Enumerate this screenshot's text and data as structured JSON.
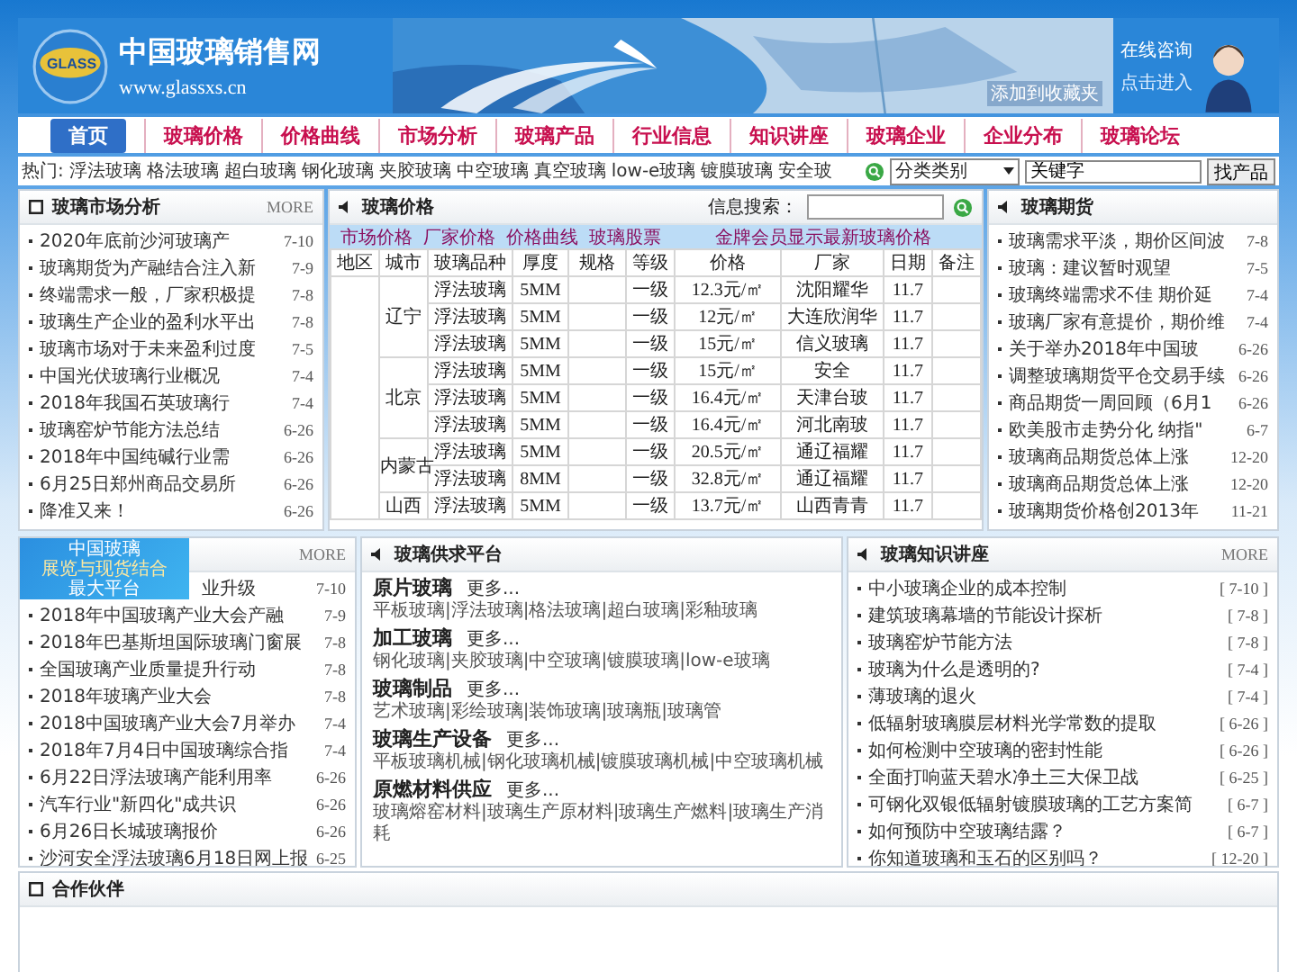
{
  "header": {
    "logo_badge": "GLASS",
    "site_name": "中国玻璃销售网",
    "site_url": "www.glassxs.cn",
    "bookmark_link": "添加到收藏夹",
    "consult_title": "在线咨询",
    "consult_link": "点击进入"
  },
  "nav": [
    {
      "label": "首页",
      "selected": true
    },
    {
      "label": "玻璃价格",
      "selected": false
    },
    {
      "label": "价格曲线",
      "selected": false
    },
    {
      "label": "市场分析",
      "selected": false
    },
    {
      "label": "玻璃产品",
      "selected": false
    },
    {
      "label": "行业信息",
      "selected": false
    },
    {
      "label": "知识讲座",
      "selected": false
    },
    {
      "label": "玻璃企业",
      "selected": false
    },
    {
      "label": "企业分布",
      "selected": false
    },
    {
      "label": "玻璃论坛",
      "selected": false
    }
  ],
  "hot": {
    "label": "热门:",
    "items": [
      "浮法玻璃",
      "格法玻璃",
      "超白玻璃",
      "钢化玻璃",
      "夹胶玻璃",
      "中空玻璃",
      "真空玻璃",
      "low-e玻璃",
      "镀膜玻璃",
      "安全玻"
    ]
  },
  "search": {
    "category": "分类类别",
    "keyword": "关键字",
    "button": "找产品"
  },
  "market_analysis": {
    "title": "玻璃市场分析",
    "more": "MORE",
    "items": [
      {
        "title": "2020年底前沙河玻璃产",
        "date": "7-10"
      },
      {
        "title": "玻璃期货为产融结合注入新",
        "date": "7-9"
      },
      {
        "title": "终端需求一般，厂家积极提",
        "date": "7-8"
      },
      {
        "title": "玻璃生产企业的盈利水平出",
        "date": "7-8"
      },
      {
        "title": "玻璃市场对于未来盈利过度",
        "date": "7-5"
      },
      {
        "title": "中国光伏玻璃行业概况",
        "date": "7-4"
      },
      {
        "title": "2018年我国石英玻璃行",
        "date": "7-4"
      },
      {
        "title": "玻璃窑炉节能方法总结",
        "date": "6-26"
      },
      {
        "title": "2018年中国纯碱行业需",
        "date": "6-26"
      },
      {
        "title": "6月25日郑州商品交易所",
        "date": "6-26"
      },
      {
        "title": "降准又来！",
        "date": "6-26"
      }
    ]
  },
  "prices": {
    "title": "玻璃价格",
    "search_label": "信息搜索：",
    "tabs": [
      "市场价格",
      "厂家价格",
      "价格曲线",
      "玻璃股票"
    ],
    "notice": "金牌会员显示最新玻璃价格",
    "columns": [
      "地区",
      "城市",
      "玻璃品种",
      "厚度",
      "规格",
      "等级",
      "价格",
      "厂家",
      "日期",
      "备注"
    ],
    "groups": [
      {
        "city": "辽宁",
        "rows": [
          {
            "variety": "浮法玻璃",
            "thickness": "5MM",
            "grade": "一级",
            "price": "12.3元/㎡",
            "maker": "沈阳耀华",
            "date": "11.7"
          },
          {
            "variety": "浮法玻璃",
            "thickness": "5MM",
            "grade": "一级",
            "price": "12元/㎡",
            "maker": "大连欣润华",
            "date": "11.7"
          },
          {
            "variety": "浮法玻璃",
            "thickness": "5MM",
            "grade": "一级",
            "price": "15元/㎡",
            "maker": "信义玻璃",
            "date": "11.7"
          }
        ]
      },
      {
        "city": "北京",
        "rows": [
          {
            "variety": "浮法玻璃",
            "thickness": "5MM",
            "grade": "一级",
            "price": "15元/㎡",
            "maker": "安全",
            "date": "11.7"
          },
          {
            "variety": "浮法玻璃",
            "thickness": "5MM",
            "grade": "一级",
            "price": "16.4元/㎡",
            "maker": "天津台玻",
            "date": "11.7"
          },
          {
            "variety": "浮法玻璃",
            "thickness": "5MM",
            "grade": "一级",
            "price": "16.4元/㎡",
            "maker": "河北南玻",
            "date": "11.7"
          }
        ]
      },
      {
        "city": "内蒙古",
        "rows": [
          {
            "variety": "浮法玻璃",
            "thickness": "5MM",
            "grade": "一级",
            "price": "20.5元/㎡",
            "maker": "通辽福耀",
            "date": "11.7"
          },
          {
            "variety": "浮法玻璃",
            "thickness": "8MM",
            "grade": "一级",
            "price": "32.8元/㎡",
            "maker": "通辽福耀",
            "date": "11.7"
          }
        ]
      },
      {
        "city": "山西",
        "rows": [
          {
            "variety": "浮法玻璃",
            "thickness": "5MM",
            "grade": "一级",
            "price": "13.7元/㎡",
            "maker": "山西青青",
            "date": "11.7"
          }
        ]
      }
    ]
  },
  "futures": {
    "title": "玻璃期货",
    "items": [
      {
        "title": "玻璃需求平淡，期价区间波",
        "date": "7-8"
      },
      {
        "title": "玻璃：建议暂时观望",
        "date": "7-5"
      },
      {
        "title": "玻璃终端需求不佳 期价延",
        "date": "7-4"
      },
      {
        "title": "玻璃厂家有意提价，期价维",
        "date": "7-4"
      },
      {
        "title": "关于举办2018年中国玻",
        "date": "6-26"
      },
      {
        "title": "调整玻璃期货平仓交易手续",
        "date": "6-26"
      },
      {
        "title": "商品期货一周回顾（6月1",
        "date": "6-26"
      },
      {
        "title": "欧美股市走势分化 纳指\"",
        "date": "6-7"
      },
      {
        "title": "玻璃商品期货总体上涨",
        "date": "12-20"
      },
      {
        "title": "玻璃商品期货总体上涨",
        "date": "12-20"
      },
      {
        "title": "玻璃期货价格创2013年",
        "date": "11-21"
      }
    ]
  },
  "industry_news": {
    "more": "MORE",
    "ad": {
      "lines": [
        "中国玻璃",
        "展览与现货结合",
        "最大平台"
      ]
    },
    "items": [
      {
        "title": "业升级",
        "date": "7-10"
      },
      {
        "title": "2018年中国玻璃产业大会产融",
        "date": "7-9"
      },
      {
        "title": "2018年巴基斯坦国际玻璃门窗展",
        "date": "7-8"
      },
      {
        "title": "全国玻璃产业质量提升行动",
        "date": "7-8"
      },
      {
        "title": "2018年玻璃产业大会",
        "date": "7-8"
      },
      {
        "title": "2018中国玻璃产业大会7月举办",
        "date": "7-4"
      },
      {
        "title": "2018年7月4日中国玻璃综合指",
        "date": "7-4"
      },
      {
        "title": "6月22日浮法玻璃产能利用率",
        "date": "6-26"
      },
      {
        "title": "汽车行业\"新四化\"成共识",
        "date": "6-26"
      },
      {
        "title": "6月26日长城玻璃报价",
        "date": "6-26"
      },
      {
        "title": "沙河安全浮法玻璃6月18日网上报",
        "date": "6-25"
      }
    ]
  },
  "supply": {
    "title": "玻璃供求平台",
    "categories": [
      {
        "name": "原片玻璃",
        "more": "更多...",
        "links": "平板玻璃|浮法玻璃|格法玻璃|超白玻璃|彩釉玻璃"
      },
      {
        "name": "加工玻璃",
        "more": "更多...",
        "links": "钢化玻璃|夹胶玻璃|中空玻璃|镀膜玻璃|low-e玻璃"
      },
      {
        "name": "玻璃制品",
        "more": "更多...",
        "links": "艺术玻璃|彩绘玻璃|装饰玻璃|玻璃瓶|玻璃管"
      },
      {
        "name": "玻璃生产设备",
        "more": "更多...",
        "links": "平板玻璃机械|钢化玻璃机械|镀膜玻璃机械|中空玻璃机械"
      },
      {
        "name": "原燃材料供应",
        "more": "更多...",
        "links": "玻璃熔窑材料|玻璃生产原材料|玻璃生产燃料|玻璃生产消耗"
      }
    ]
  },
  "knowledge": {
    "title": "玻璃知识讲座",
    "more": "MORE",
    "items": [
      {
        "title": "中小玻璃企业的成本控制",
        "date": "[ 7-10 ]"
      },
      {
        "title": "建筑玻璃幕墙的节能设计探析",
        "date": "[ 7-8 ]"
      },
      {
        "title": "玻璃窑炉节能方法",
        "date": "[ 7-8 ]"
      },
      {
        "title": "玻璃为什么是透明的?",
        "date": "[ 7-4 ]"
      },
      {
        "title": "薄玻璃的退火",
        "date": "[ 7-4 ]"
      },
      {
        "title": "低辐射玻璃膜层材料光学常数的提取",
        "date": "[ 6-26 ]"
      },
      {
        "title": "如何检测中空玻璃的密封性能",
        "date": "[ 6-26 ]"
      },
      {
        "title": "全面打响蓝天碧水净土三大保卫战",
        "date": "[ 6-25 ]"
      },
      {
        "title": "可钢化双银低辐射镀膜玻璃的工艺方案简",
        "date": "[ 6-7 ]"
      },
      {
        "title": "如何预防中空玻璃结露？",
        "date": "[ 6-7 ]"
      },
      {
        "title": "你知道玻璃和玉石的区别吗？",
        "date": "[ 12-20 ]"
      }
    ]
  },
  "partners": {
    "title": "合作伙伴"
  }
}
